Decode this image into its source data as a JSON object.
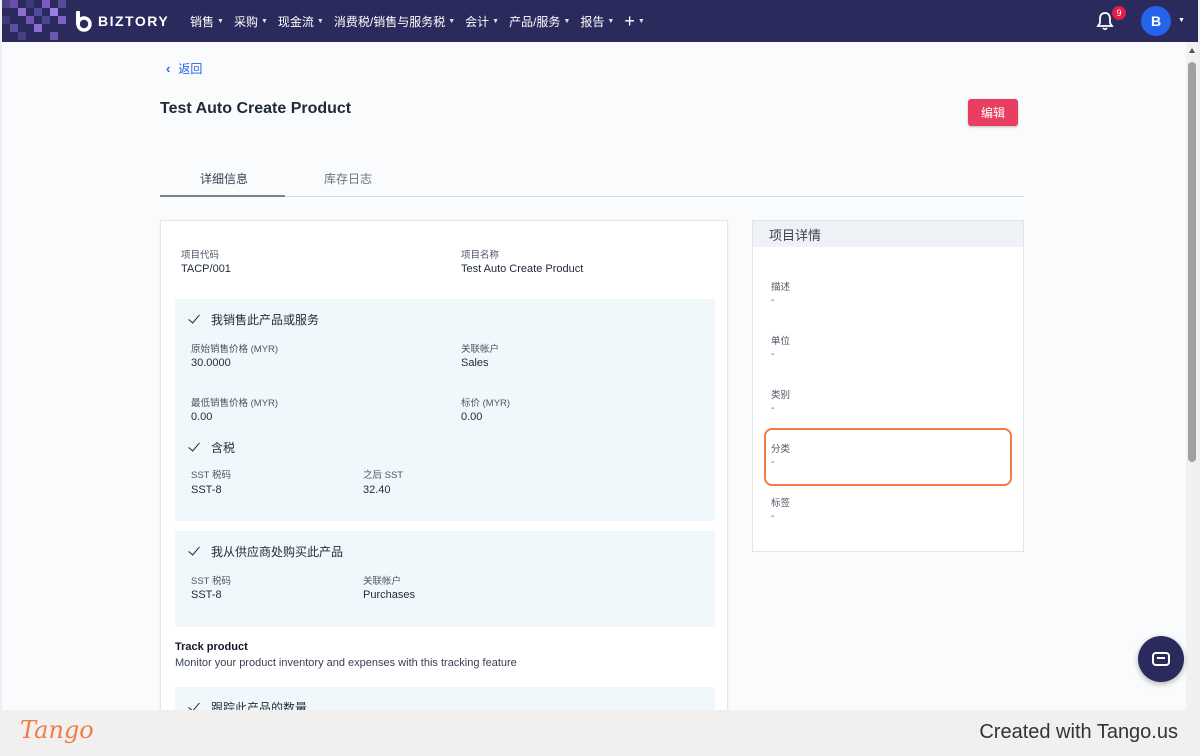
{
  "nav": {
    "brand": "BIZTORY",
    "menu": [
      {
        "label": "销售"
      },
      {
        "label": "采购"
      },
      {
        "label": "现金流"
      },
      {
        "label": "消费税/销售与服务税"
      },
      {
        "label": "会计"
      },
      {
        "label": "产品/服务"
      },
      {
        "label": "报告"
      }
    ],
    "notification_count": "9",
    "avatar_initial": "B"
  },
  "page": {
    "back_label": "返回",
    "title": "Test Auto Create Product",
    "edit_label": "编辑",
    "tabs": [
      {
        "label": "详细信息",
        "active": true
      },
      {
        "label": "库存日志",
        "active": false
      }
    ]
  },
  "main": {
    "item_code_label": "项目代码",
    "item_code": "TACP/001",
    "item_name_label": "项目名称",
    "item_name": "Test Auto Create Product",
    "sell": {
      "heading": "我销售此产品或服务",
      "original_price_label": "原始销售价格 (MYR)",
      "original_price": "30.0000",
      "account_label": "关联帐户",
      "account": "Sales",
      "min_price_label": "最低销售价格 (MYR)",
      "min_price": "0.00",
      "markup_label": "标价 (MYR)",
      "markup": "0.00",
      "tax_heading": "含税",
      "sst_code_label": "SST 税码",
      "sst_code": "SST-8",
      "after_sst_label": "之后 SST",
      "after_sst": "32.40"
    },
    "buy": {
      "heading": "我从供应商处购买此产品",
      "sst_code_label": "SST 税码",
      "sst_code": "SST-8",
      "account_label": "关联帐户",
      "account": "Purchases"
    },
    "track": {
      "title": "Track product",
      "description": "Monitor your product inventory and expenses with this tracking feature",
      "heading": "跟踪此产品的数量"
    }
  },
  "side": {
    "heading": "项目详情",
    "fields": [
      {
        "label": "描述",
        "value": "-"
      },
      {
        "label": "单位",
        "value": "-"
      },
      {
        "label": "类别",
        "value": "-"
      },
      {
        "label": "分类",
        "value": "-"
      },
      {
        "label": "标签",
        "value": "-"
      }
    ]
  },
  "footer": {
    "logo": "Tango",
    "created": "Created with Tango.us"
  },
  "colors": {
    "nav_bg": "#2b2a5c",
    "edit_button": "#e83e62",
    "highlight": "#f07c4a",
    "link": "#2563eb"
  }
}
